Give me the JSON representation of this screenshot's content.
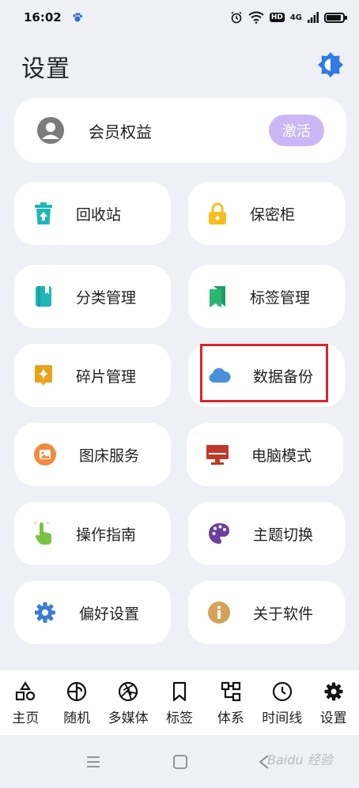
{
  "status_bar": {
    "time": "16:02",
    "hd": "HD",
    "network": "4G"
  },
  "header": {
    "title": "设置"
  },
  "member": {
    "label": "会员权益",
    "button": "激活"
  },
  "tiles": [
    {
      "label": "回收站",
      "icon": "trash-icon",
      "color": "#1fb6b6"
    },
    {
      "label": "保密柜",
      "icon": "lock-icon",
      "color": "#f5bd1e"
    },
    {
      "label": "分类管理",
      "icon": "book-icon",
      "color": "#1fb6b6"
    },
    {
      "label": "标签管理",
      "icon": "bookmark-icon",
      "color": "#2bb673"
    },
    {
      "label": "碎片管理",
      "icon": "sparkle-icon",
      "color": "#e8a21d"
    },
    {
      "label": "数据备份",
      "icon": "cloud-icon",
      "color": "#4a90d9"
    },
    {
      "label": "图床服务",
      "icon": "image-icon",
      "color": "#f08a3e"
    },
    {
      "label": "电脑模式",
      "icon": "monitor-icon",
      "color": "#c0392b"
    },
    {
      "label": "操作指南",
      "icon": "pointer-hand-icon",
      "color": "#7cc243"
    },
    {
      "label": "主题切换",
      "icon": "palette-icon",
      "color": "#6a3fa0"
    },
    {
      "label": "偏好设置",
      "icon": "gear-icon",
      "color": "#3a7bd5"
    },
    {
      "label": "关于软件",
      "icon": "info-icon",
      "color": "#d4a15a"
    }
  ],
  "bottom_nav": [
    {
      "label": "主页",
      "icon": "shapes-icon"
    },
    {
      "label": "随机",
      "icon": "random-icon"
    },
    {
      "label": "多媒体",
      "icon": "aperture-icon"
    },
    {
      "label": "标签",
      "icon": "bookmark-outline-icon"
    },
    {
      "label": "体系",
      "icon": "hierarchy-icon"
    },
    {
      "label": "时间线",
      "icon": "clock-icon"
    },
    {
      "label": "设置",
      "icon": "gear-icon"
    }
  ],
  "watermark": "Baidu 经验",
  "colors": {
    "accent": "#2f7ae5",
    "activate": "#cbb7f6",
    "highlight": "#d9262c",
    "background": "#eef0f6"
  }
}
